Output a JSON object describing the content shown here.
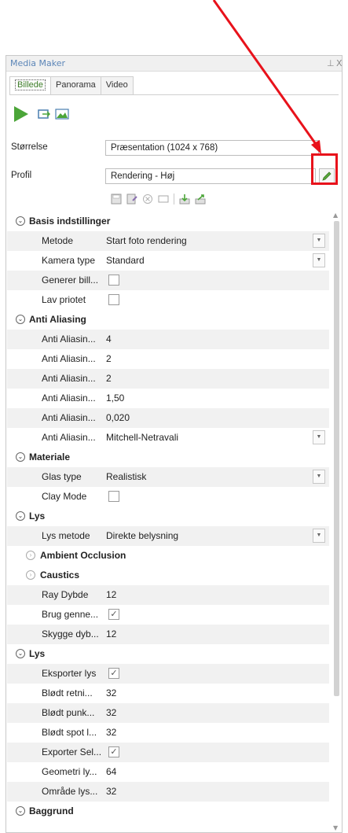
{
  "window": {
    "title": "Media Maker",
    "pin_glyph": "⊥",
    "close_glyph": "X"
  },
  "tabs": [
    {
      "label": "Billede",
      "active": true
    },
    {
      "label": "Panorama",
      "active": false
    },
    {
      "label": "Video",
      "active": false
    }
  ],
  "toolbar": {
    "icons": [
      "play-icon",
      "export-icon",
      "image-icon"
    ]
  },
  "size": {
    "label": "Størrelse",
    "value": "Præsentation (1024 x 768)"
  },
  "profile": {
    "label": "Profil",
    "value": "Rendering - Høj",
    "tools": [
      "save-icon",
      "save-as-icon",
      "delete-icon",
      "rename-icon",
      "import-icon",
      "export-icon"
    ]
  },
  "grid": {
    "categories": [
      {
        "label": "Basis indstillinger",
        "toggle": "⌄",
        "rows": [
          {
            "name": "Metode",
            "value": "Start foto rendering",
            "type": "dropdown"
          },
          {
            "name": "Kamera type",
            "value": "Standard",
            "type": "dropdown"
          },
          {
            "name": "Generer bill...",
            "value": "",
            "type": "checkbox",
            "checked": false
          },
          {
            "name": "Lav priotet",
            "value": "",
            "type": "checkbox",
            "checked": false
          }
        ]
      },
      {
        "label": "Anti Aliasing",
        "toggle": "⌄",
        "rows": [
          {
            "name": "Anti Aliasin...",
            "value": "4",
            "type": "text"
          },
          {
            "name": "Anti Aliasin...",
            "value": "2",
            "type": "text"
          },
          {
            "name": "Anti Aliasin...",
            "value": "2",
            "type": "text"
          },
          {
            "name": "Anti Aliasin...",
            "value": "1,50",
            "type": "text"
          },
          {
            "name": "Anti Aliasin...",
            "value": "0,020",
            "type": "text"
          },
          {
            "name": "Anti Aliasin...",
            "value": "Mitchell-Netravali",
            "type": "dropdown"
          }
        ]
      },
      {
        "label": "Materiale",
        "toggle": "⌄",
        "rows": [
          {
            "name": "Glas type",
            "value": "Realistisk",
            "type": "dropdown"
          },
          {
            "name": "Clay Mode",
            "value": "",
            "type": "checkbox",
            "checked": false
          }
        ]
      },
      {
        "label": "Lys",
        "toggle": "⌄",
        "rows": [
          {
            "name": "Lys metode",
            "value": "Direkte belysning",
            "type": "dropdown"
          }
        ]
      },
      {
        "label": "Ambient Occlusion",
        "toggle": "›",
        "sub": true,
        "rows": []
      },
      {
        "label": "Caustics",
        "toggle": "›",
        "sub": true,
        "rows": [
          {
            "name": "Ray Dybde",
            "value": "12",
            "type": "text"
          },
          {
            "name": "Brug genne...",
            "value": "",
            "type": "checkbox",
            "checked": true
          },
          {
            "name": "Skygge dyb...",
            "value": "12",
            "type": "text"
          }
        ]
      },
      {
        "label": "Lys",
        "toggle": "⌄",
        "rows": [
          {
            "name": "Eksporter lys",
            "value": "",
            "type": "checkbox",
            "checked": true
          },
          {
            "name": "Blødt retni...",
            "value": "32",
            "type": "text"
          },
          {
            "name": "Blødt punk...",
            "value": "32",
            "type": "text"
          },
          {
            "name": "Blødt spot l...",
            "value": "32",
            "type": "text"
          },
          {
            "name": "Exporter Sel...",
            "value": "",
            "type": "checkbox",
            "checked": true
          },
          {
            "name": "Geometri ly...",
            "value": "64",
            "type": "text"
          },
          {
            "name": "Område lys...",
            "value": "32",
            "type": "text"
          }
        ]
      },
      {
        "label": "Baggrund",
        "toggle": "⌄",
        "rows": []
      }
    ]
  },
  "colors": {
    "accent_green": "#4ba538",
    "title_blue": "#5c86b8",
    "annotation_red": "#e8121b"
  },
  "annotation": {
    "description_icon": "red-arrow-annotation"
  }
}
